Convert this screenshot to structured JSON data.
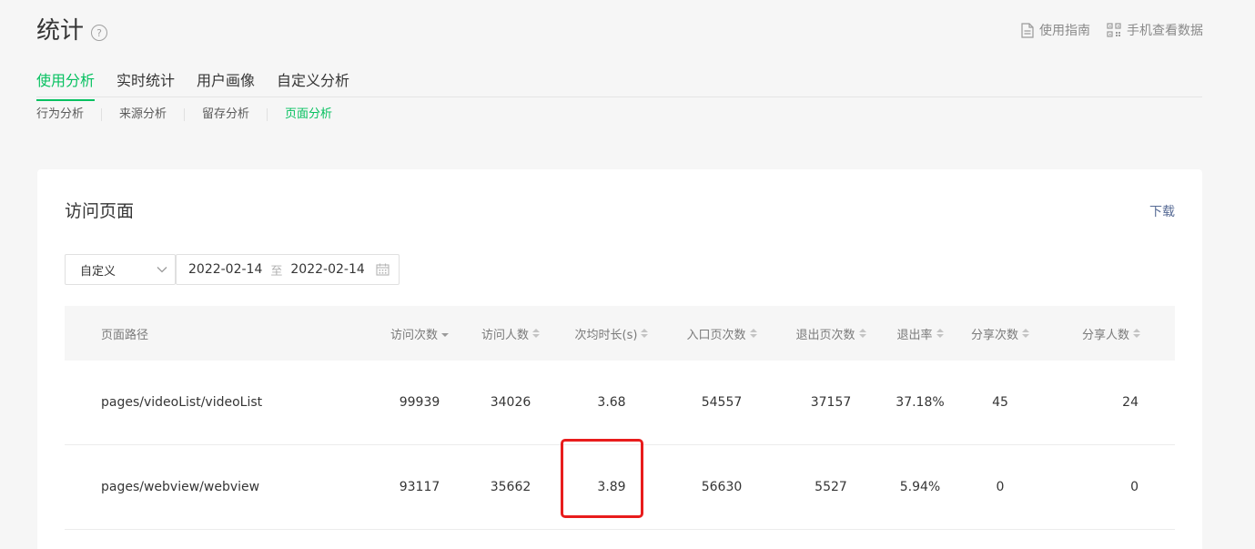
{
  "header": {
    "title": "统计",
    "help_icon": "?",
    "links": [
      {
        "label": "使用指南",
        "icon": "document-icon"
      },
      {
        "label": "手机查看数据",
        "icon": "qrcode-icon"
      }
    ]
  },
  "tabs": [
    {
      "label": "使用分析",
      "active": true
    },
    {
      "label": "实时统计",
      "active": false
    },
    {
      "label": "用户画像",
      "active": false
    },
    {
      "label": "自定义分析",
      "active": false
    }
  ],
  "subtabs": [
    {
      "label": "行为分析",
      "active": false
    },
    {
      "label": "来源分析",
      "active": false
    },
    {
      "label": "留存分析",
      "active": false
    },
    {
      "label": "页面分析",
      "active": true
    }
  ],
  "card": {
    "title": "访问页面",
    "download_label": "下载",
    "select_value": "自定义",
    "date_start": "2022-02-14",
    "date_sep": "至",
    "date_end": "2022-02-14"
  },
  "table": {
    "columns": [
      "页面路径",
      "访问次数",
      "访问人数",
      "次均时长(s)",
      "入口页次数",
      "退出页次数",
      "退出率",
      "分享次数",
      "分享人数"
    ],
    "rows": [
      [
        "pages/videoList/videoList",
        "99939",
        "34026",
        "3.68",
        "54557",
        "37157",
        "37.18%",
        "45",
        "24"
      ],
      [
        "pages/webview/webview",
        "93117",
        "35662",
        "3.89",
        "56630",
        "5527",
        "5.94%",
        "0",
        "0"
      ]
    ]
  },
  "colors": {
    "accent": "#07c160",
    "link": "#576b95",
    "highlight_box": "#e81c1c"
  }
}
